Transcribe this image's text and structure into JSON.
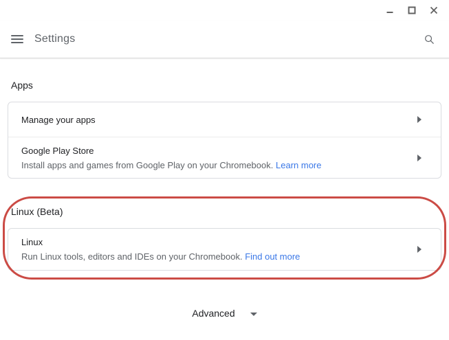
{
  "window": {
    "controls": {
      "minimize": "minimize",
      "maximize": "maximize",
      "close": "close"
    }
  },
  "header": {
    "title": "Settings",
    "menu_icon": "hamburger-menu",
    "search_icon": "magnifying-glass"
  },
  "sections": [
    {
      "heading": "Apps",
      "rows": [
        {
          "title": "Manage your apps",
          "subtitle": "",
          "link": "",
          "trailing_icon": "arrow-right-triangle"
        },
        {
          "title": "Google Play Store",
          "subtitle": "Install apps and games from Google Play on your Chromebook.",
          "link": "Learn more",
          "trailing_icon": "arrow-right-triangle"
        }
      ]
    },
    {
      "heading": "Linux (Beta)",
      "annotated": true,
      "rows": [
        {
          "title": "Linux",
          "subtitle": "Run Linux tools, editors and IDEs on your Chromebook.",
          "link": "Find out more",
          "trailing_icon": "arrow-right-triangle"
        }
      ]
    }
  ],
  "footer": {
    "advanced_label": "Advanced",
    "advanced_icon": "caret-down"
  },
  "colors": {
    "link_blue": "#3b78e7",
    "annotation_red": "#cb4b45",
    "text_primary": "#202124",
    "text_secondary": "#5f6368",
    "card_border": "#dadce0"
  }
}
